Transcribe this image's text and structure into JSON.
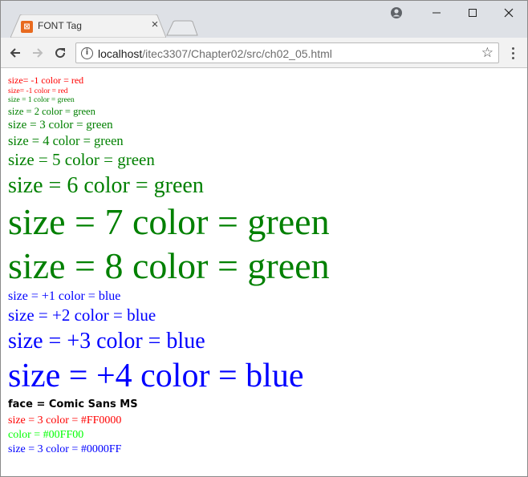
{
  "browser": {
    "tab_title": "FONT Tag",
    "tab_favicon_glyph": "⊠",
    "url_host": "localhost",
    "url_path": "/itec3307/Chapter02/src/ch02_05.html",
    "icons": {
      "back": "back-arrow-icon",
      "forward": "forward-arrow-icon",
      "reload": "reload-icon",
      "info": "info-icon",
      "bookmark": "star-icon",
      "menu": "kebab-menu-icon",
      "profile": "account-icon",
      "minimize": "minimize-icon",
      "maximize": "maximize-icon",
      "close": "close-icon"
    }
  },
  "page": {
    "lines": [
      "size= -1 color = red",
      "size= -1 color = red",
      "size = 1 color = green",
      "size = 2 color = green",
      "size = 3 color = green",
      "size = 4 color = green",
      "size = 5 color = green",
      "size = 6 color = green",
      "size = 7 color = green",
      "size = 8 color = green",
      "size = +1 color = blue",
      "size = +2 color = blue",
      "size = +3 color = blue",
      "size = +4 color = blue",
      "face = Comic Sans MS",
      "size = 3 color = #FF0000",
      "color = #00FF00",
      "size = 3 color = #0000FF"
    ],
    "colors": {
      "red": "#FF0000",
      "green": "#008000",
      "blue": "#0000FF",
      "lime": "#00FF00",
      "black": "#000000"
    }
  }
}
